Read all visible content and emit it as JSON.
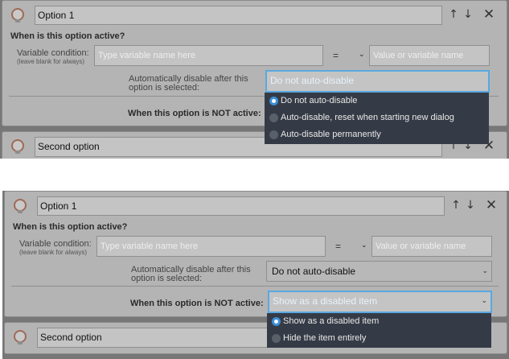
{
  "top": {
    "option1": {
      "title": "Option 1",
      "question": "When is this option active?",
      "var_label": "Variable condition:",
      "var_hint": "(leave blank for always)",
      "var_placeholder": "Type variable name here",
      "operator": "=",
      "value_placeholder": "Value or variable name",
      "auto_label": "Automatically disable after this option is selected:",
      "auto_value": "Do not auto-disable",
      "not_active_label": "When this option is NOT active:"
    },
    "dropdown": [
      "Do not auto-disable",
      "Auto-disable, reset when starting new dialog",
      "Auto-disable permanently"
    ],
    "dropdown_selected": 0,
    "second_title": "Second option"
  },
  "bottom": {
    "option1": {
      "title": "Option 1",
      "question": "When is this option active?",
      "var_label": "Variable condition:",
      "var_hint": "(leave blank for always)",
      "var_placeholder": "Type variable name here",
      "operator": "=",
      "value_placeholder": "Value or variable name",
      "auto_label": "Automatically disable after this option is selected:",
      "auto_value": "Do not auto-disable",
      "not_active_label": "When this option is NOT active:",
      "not_active_value": "Show as a disabled item"
    },
    "dropdown": [
      "Show as a disabled item",
      "Hide the item entirely"
    ],
    "dropdown_selected": 0,
    "second_title": "Second option"
  },
  "icons": {
    "bulb": "lightbulb-icon",
    "up": "arrow-up-icon",
    "down": "arrow-down-icon",
    "close": "close-icon",
    "chevron": "chevron-down-icon"
  },
  "colors": {
    "focus_border": "#5aa8e0",
    "dropdown_bg": "#353b46",
    "radio_selected": "#3d8fd6"
  }
}
